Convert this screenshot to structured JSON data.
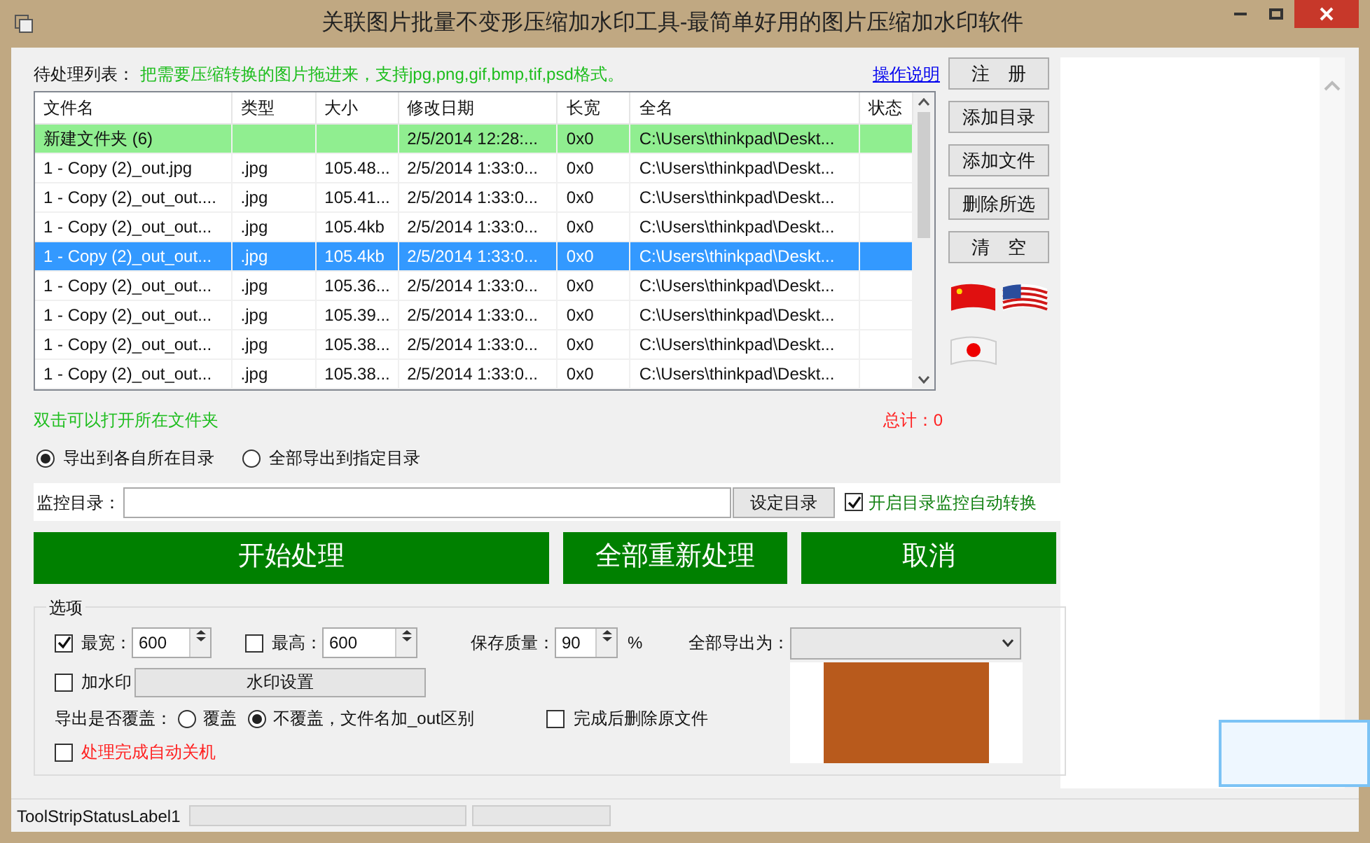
{
  "window": {
    "title": "关联图片批量不变形压缩加水印工具-最简单好用的图片压缩加水印软件"
  },
  "list_header": {
    "label": "待处理列表：",
    "hint": "把需要压缩转换的图片拖进来，支持jpg,png,gif,bmp,tif,psd格式。",
    "help_link": "操作说明"
  },
  "table": {
    "columns": [
      "文件名",
      "类型",
      "大小",
      "修改日期",
      "长宽",
      "全名",
      "状态"
    ],
    "rows": [
      {
        "kind": "folder",
        "selected": false,
        "cells": [
          "新建文件夹 (6)",
          "",
          "",
          "2/5/2014 12:28:...",
          "0x0",
          "C:\\Users\\thinkpad\\Deskt...",
          ""
        ]
      },
      {
        "kind": "file",
        "selected": false,
        "cells": [
          "1 - Copy (2)_out.jpg",
          ".jpg",
          "105.48...",
          "2/5/2014 1:33:0...",
          "0x0",
          "C:\\Users\\thinkpad\\Deskt...",
          ""
        ]
      },
      {
        "kind": "file",
        "selected": false,
        "cells": [
          "1 - Copy (2)_out_out....",
          ".jpg",
          "105.41...",
          "2/5/2014 1:33:0...",
          "0x0",
          "C:\\Users\\thinkpad\\Deskt...",
          ""
        ]
      },
      {
        "kind": "file",
        "selected": false,
        "cells": [
          "1 - Copy (2)_out_out...",
          ".jpg",
          "105.4kb",
          "2/5/2014 1:33:0...",
          "0x0",
          "C:\\Users\\thinkpad\\Deskt...",
          ""
        ]
      },
      {
        "kind": "file",
        "selected": true,
        "cells": [
          "1 - Copy (2)_out_out...",
          ".jpg",
          "105.4kb",
          "2/5/2014 1:33:0...",
          "0x0",
          "C:\\Users\\thinkpad\\Deskt...",
          ""
        ]
      },
      {
        "kind": "file",
        "selected": false,
        "cells": [
          "1 - Copy (2)_out_out...",
          ".jpg",
          "105.36...",
          "2/5/2014 1:33:0...",
          "0x0",
          "C:\\Users\\thinkpad\\Deskt...",
          ""
        ]
      },
      {
        "kind": "file",
        "selected": false,
        "cells": [
          "1 - Copy (2)_out_out...",
          ".jpg",
          "105.39...",
          "2/5/2014 1:33:0...",
          "0x0",
          "C:\\Users\\thinkpad\\Deskt...",
          ""
        ]
      },
      {
        "kind": "file",
        "selected": false,
        "cells": [
          "1 - Copy (2)_out_out...",
          ".jpg",
          "105.38...",
          "2/5/2014 1:33:0...",
          "0x0",
          "C:\\Users\\thinkpad\\Deskt...",
          ""
        ]
      },
      {
        "kind": "file",
        "selected": false,
        "cells": [
          "1 - Copy (2)_out_out...",
          ".jpg",
          "105.38...",
          "2/5/2014 1:33:0...",
          "0x0",
          "C:\\Users\\thinkpad\\Deskt...",
          ""
        ]
      }
    ]
  },
  "side_buttons": [
    "注　册",
    "添加目录",
    "添加文件",
    "删除所选",
    "清　空"
  ],
  "hint_below": "双击可以打开所在文件夹",
  "total": "总计：0",
  "export_mode": [
    {
      "label": "导出到各自所在目录",
      "selected": true
    },
    {
      "label": "全部导出到指定目录",
      "selected": false
    }
  ],
  "monitor": {
    "label": "监控目录：",
    "set_button": "设定目录",
    "auto_label": "开启目录监控自动转换",
    "auto_checked": true
  },
  "actions": [
    "开始处理",
    "全部重新处理",
    "取消"
  ],
  "options": {
    "legend": "选项",
    "max_width": {
      "label": "最宽：",
      "value": "600",
      "checked": true
    },
    "max_height": {
      "label": "最高：",
      "value": "600",
      "checked": false
    },
    "quality": {
      "label": "保存质量：",
      "value": "90",
      "unit": "%"
    },
    "export_as": {
      "label": "全部导出为："
    },
    "watermark": {
      "label": "加水印",
      "checked": false,
      "button": "水印设置"
    },
    "overwrite": {
      "label": "导出是否覆盖：",
      "choices": [
        {
          "label": "覆盖",
          "selected": false
        },
        {
          "label": "不覆盖，文件名加_out区别",
          "selected": true
        }
      ]
    },
    "delete_original": {
      "label": "完成后删除原文件",
      "checked": false
    },
    "shutdown": {
      "label": "处理完成自动关机",
      "checked": false
    }
  },
  "status_bar": {
    "label": "ToolStripStatusLabel1"
  }
}
